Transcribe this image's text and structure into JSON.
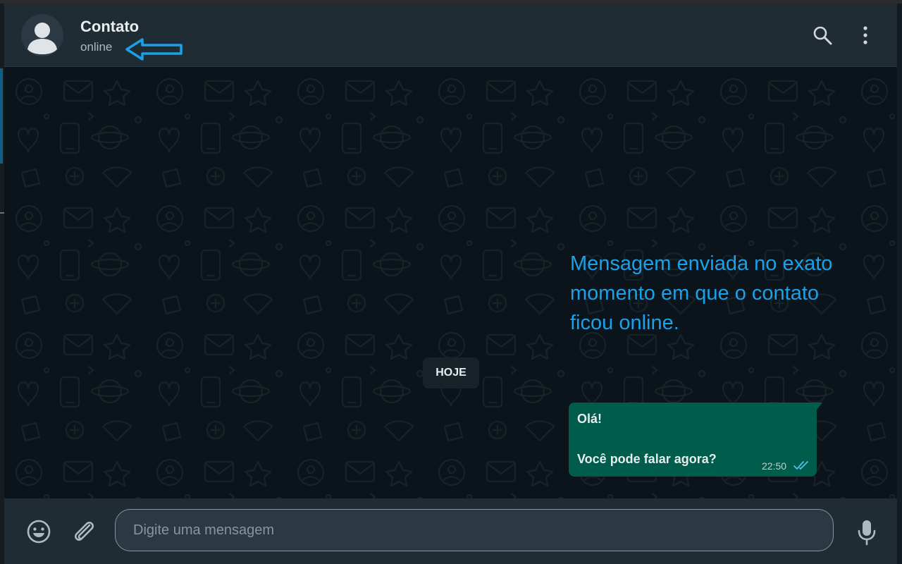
{
  "header": {
    "contact_name": "Contato",
    "status": "online"
  },
  "chat": {
    "day_label": "HOJE",
    "message": {
      "line1": "Olá!",
      "line2": "Você pode falar agora?",
      "time": "22:50",
      "status_icon": "double-check-icon"
    }
  },
  "annotation": {
    "text": "Mensagem enviada no exato momento em que o contato ficou online.",
    "color": "#1ca0e8"
  },
  "footer": {
    "input_placeholder": "Digite uma mensagem"
  },
  "icons": [
    "avatar-icon",
    "search-icon",
    "menu-icon",
    "emoji-icon",
    "attach-icon",
    "mic-icon"
  ],
  "colors": {
    "header_bg": "#202c33",
    "chat_bg": "#0b141a",
    "bubble_bg": "#005c4b",
    "chip_bg": "#182229"
  }
}
